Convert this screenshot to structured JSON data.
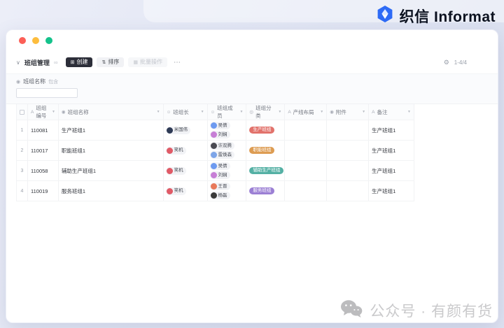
{
  "brand": {
    "name": "织信 Informat",
    "accent": "#2e6bf6"
  },
  "window_controls": {
    "close_color": "#fc5f57",
    "minimize_color": "#fdbd3e",
    "zoom_color": "#14c28b"
  },
  "toolbar": {
    "collapse_icon": "∨",
    "title": "班组管理",
    "share_icon": "∞",
    "create_icon": "⊞",
    "create_label": "创建",
    "sort_icon": "⇅",
    "sort_label": "排序",
    "batch_icon": "▦",
    "batch_label": "批量操作",
    "more_icon": "⋯",
    "settings_icon": "⚙",
    "pagination": "1-4/4"
  },
  "filter": {
    "field_icon": "◉",
    "field_label": "班组名称",
    "operator_label": "包含",
    "value": "",
    "placeholder": ""
  },
  "table": {
    "columns": [
      {
        "key": "id",
        "icon": "A",
        "label": "班组编号"
      },
      {
        "key": "name",
        "icon": "◉",
        "label": "班组名称"
      },
      {
        "key": "leader",
        "icon": "☺",
        "label": "班组长"
      },
      {
        "key": "members",
        "icon": "☺",
        "label": "班组成员"
      },
      {
        "key": "category",
        "icon": "◎",
        "label": "班组分类"
      },
      {
        "key": "layout",
        "icon": "A",
        "label": "产线布局"
      },
      {
        "key": "attachment",
        "icon": "◉",
        "label": "附件"
      },
      {
        "key": "remark",
        "icon": "A",
        "label": "备注"
      }
    ],
    "rows": [
      {
        "num": "1",
        "id": "110081",
        "name": "生产班组1",
        "leader": {
          "name": "米国伟",
          "avatar": "#2e3a55"
        },
        "members": [
          {
            "name": "吴倩",
            "avatar": "#6d9af0"
          },
          {
            "name": "刘娴",
            "avatar": "#c77fd6"
          }
        ],
        "category": {
          "label": "生产班组",
          "color": "#e2726b"
        },
        "layout": "",
        "attachment": "",
        "remark": "生产班组1"
      },
      {
        "num": "2",
        "id": "110017",
        "name": "职能班组1",
        "leader": {
          "name": "笑机",
          "avatar": "#e05a66"
        },
        "members": [
          {
            "name": "许双腾",
            "avatar": "#4a4a52"
          },
          {
            "name": "雷焕森",
            "avatar": "#7da5e8"
          }
        ],
        "category": {
          "label": "职能班组",
          "color": "#dd9c52"
        },
        "layout": "",
        "attachment": "",
        "remark": "生产班组1"
      },
      {
        "num": "3",
        "id": "110058",
        "name": "辅助生产班组1",
        "leader": {
          "name": "笑机",
          "avatar": "#e05a66"
        },
        "members": [
          {
            "name": "吴倩",
            "avatar": "#6d9af0"
          },
          {
            "name": "刘娴",
            "avatar": "#c77fd6"
          }
        ],
        "category": {
          "label": "辅助生产班组",
          "color": "#54b0a4"
        },
        "layout": "",
        "attachment": "",
        "remark": "生产班组1"
      },
      {
        "num": "4",
        "id": "110019",
        "name": "服务班组1",
        "leader": {
          "name": "笑机",
          "avatar": "#e05a66"
        },
        "members": [
          {
            "name": "王晋",
            "avatar": "#e8795a"
          },
          {
            "name": "杨磊",
            "avatar": "#3a3a3a"
          }
        ],
        "category": {
          "label": "服务班组",
          "color": "#9b7fd4"
        },
        "layout": "",
        "attachment": "",
        "remark": "生产班组1"
      }
    ]
  },
  "watermark": {
    "text": "公众号 · 有颜有货"
  }
}
